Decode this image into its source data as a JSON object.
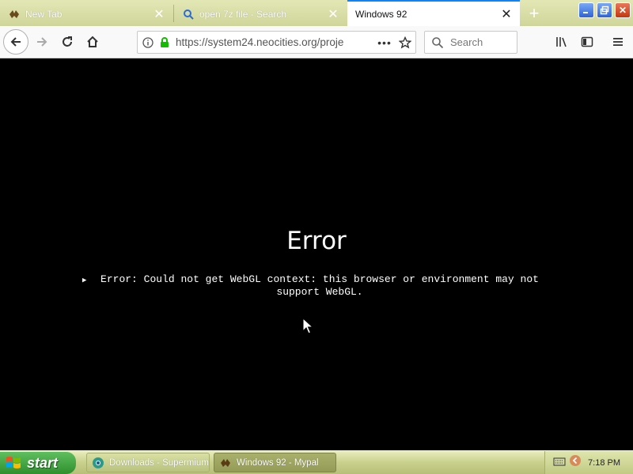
{
  "browser": {
    "tabs": [
      {
        "label": "New Tab",
        "active": false
      },
      {
        "label": "open 7z file - Search",
        "active": false
      },
      {
        "label": "Windows 92",
        "active": true
      }
    ],
    "url": "https://system24.neocities.org/proje",
    "search_placeholder": "Search"
  },
  "page": {
    "error_title": "Error",
    "error_message": "Error: Could not get WebGL context: this browser or environment may not support WebGL."
  },
  "taskbar": {
    "start_label": "start",
    "tasks": [
      {
        "label": "Downloads - Supermium"
      },
      {
        "label": "Windows 92 - Mypal"
      }
    ],
    "clock": "7:18 PM"
  },
  "colors": {
    "accent": "#0a84ff",
    "taskbar": "#c8d08c",
    "start_button": "#3f9f3f",
    "content_bg": "#000000"
  }
}
